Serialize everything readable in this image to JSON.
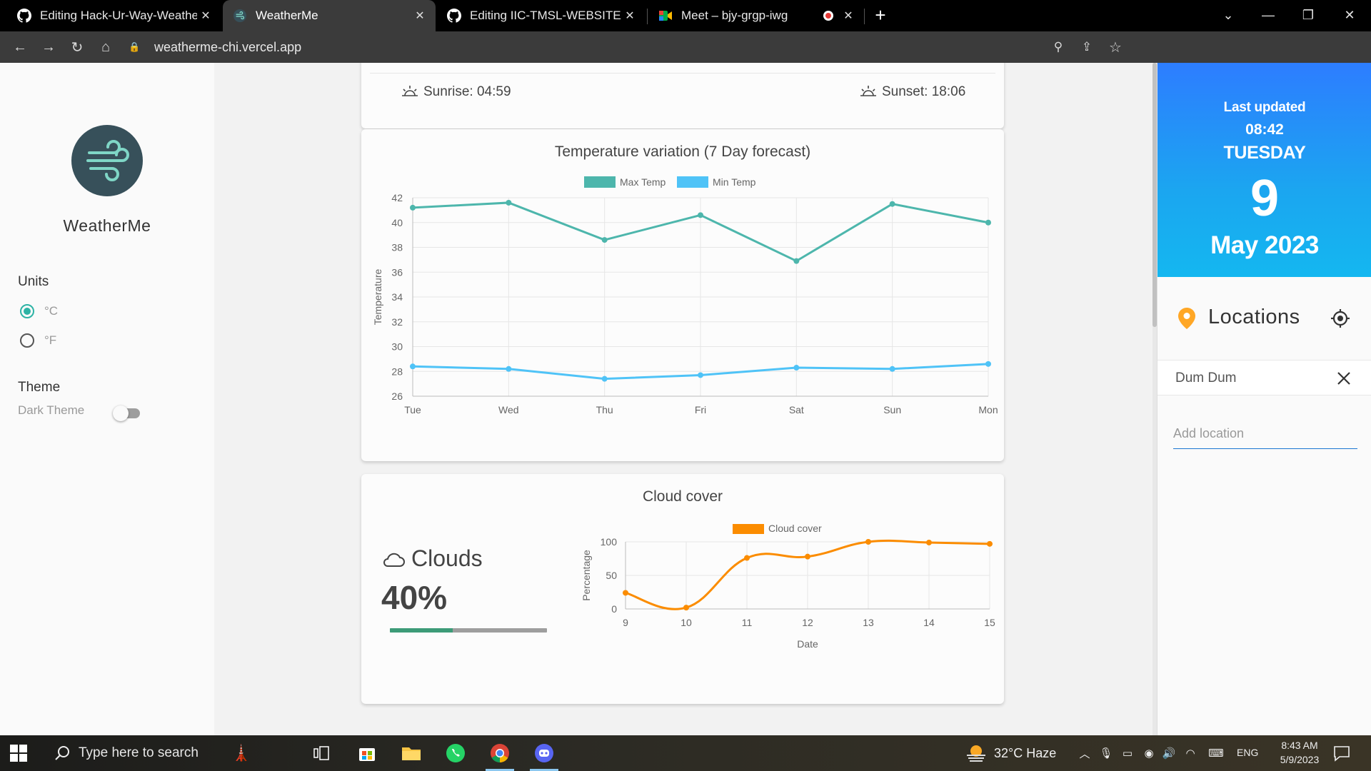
{
  "browser": {
    "tabs": [
      {
        "title": "Editing Hack-Ur-Way-WeatherMe",
        "icon": "github-icon",
        "active": false
      },
      {
        "title": "WeatherMe",
        "icon": "weatherme-favicon",
        "active": true
      },
      {
        "title": "Editing IIC-TMSL-WEBSITE/READM",
        "icon": "github-icon",
        "active": false
      },
      {
        "title": "Meet – bjy-grgp-iwg",
        "icon": "meet-icon",
        "active": false
      }
    ],
    "url": "weatherme-chi.vercel.app"
  },
  "sidebar": {
    "app_name": "WeatherMe",
    "units_title": "Units",
    "unit_c": "°C",
    "unit_f": "°F",
    "selected_unit": "°C",
    "theme_title": "Theme",
    "dark_theme_label": "Dark Theme",
    "dark_theme_on": false
  },
  "sun": {
    "sunrise": "Sunrise: 04:59",
    "sunset": "Sunset: 18:06"
  },
  "temp_chart": {
    "title": "Temperature variation (7 Day forecast)"
  },
  "cloud_card": {
    "title": "Cloud cover",
    "label": "Clouds",
    "value": "40%",
    "fraction": 0.4
  },
  "chart_data": [
    {
      "type": "line",
      "title": "Temperature variation (7 Day forecast)",
      "categories": [
        "Tue",
        "Wed",
        "Thu",
        "Fri",
        "Sat",
        "Sun",
        "Mon"
      ],
      "series": [
        {
          "name": "Max Temp",
          "color": "#4db6ac",
          "values": [
            41.2,
            41.6,
            38.6,
            40.6,
            36.9,
            41.5,
            40.0
          ]
        },
        {
          "name": "Min Temp",
          "color": "#4fc3f7",
          "values": [
            28.4,
            28.2,
            27.4,
            27.7,
            28.3,
            28.2,
            28.6
          ]
        }
      ],
      "ylabel": "Temperature",
      "xlabel": "",
      "ylim": [
        26,
        42
      ],
      "yticks": [
        26,
        28,
        30,
        32,
        34,
        36,
        38,
        40,
        42
      ],
      "grid": true,
      "legend": "top"
    },
    {
      "type": "line",
      "title": "",
      "x": [
        9,
        10,
        11,
        12,
        13,
        14,
        15
      ],
      "series": [
        {
          "name": "Cloud cover",
          "color": "#fb8c00",
          "values": [
            24,
            2,
            76,
            78,
            100,
            99,
            97
          ]
        }
      ],
      "xlabel": "Date",
      "ylabel": "Percentage",
      "ylim": [
        0,
        100
      ],
      "yticks": [
        0,
        50,
        100
      ],
      "grid": true,
      "legend": "top"
    }
  ],
  "date_panel": {
    "last_updated_label": "Last updated",
    "last_updated_time": "08:42",
    "weekday": "TUESDAY",
    "day": "9",
    "month_year": "May 2023"
  },
  "locations": {
    "title": "Locations",
    "items": [
      "Dum Dum"
    ],
    "add_placeholder": "Add location"
  },
  "taskbar": {
    "search_placeholder": "Type here to search",
    "weather": "32°C  Haze",
    "language": "ENG",
    "time": "8:43 AM",
    "date": "5/9/2023"
  }
}
